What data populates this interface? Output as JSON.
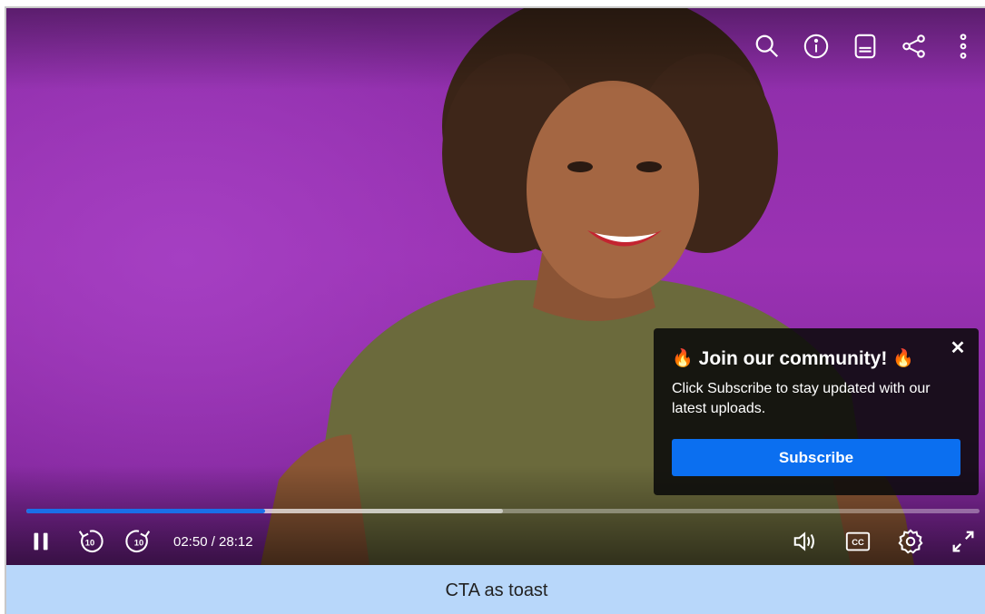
{
  "player": {
    "current_time": "02:50",
    "duration": "28:12",
    "time_display": "02:50 / 28:12",
    "progress_played_fraction": 0.25,
    "progress_buffered_fraction": 0.5,
    "colors": {
      "accent": "#0b6ff0",
      "progress": "#1a6fe8",
      "caption_bg": "#b8d7fa"
    }
  },
  "top_controls": [
    "search-icon",
    "info-icon",
    "transcript-icon",
    "share-icon",
    "more-vertical-icon"
  ],
  "bottom_controls": {
    "left": [
      "pause-icon",
      "rewind-10-icon",
      "forward-10-icon"
    ],
    "right": [
      "volume-icon",
      "closed-captions-icon",
      "settings-icon",
      "fullscreen-icon"
    ],
    "rewind_label": "10",
    "forward_label": "10",
    "cc_label": "CC"
  },
  "toast": {
    "flame": "🔥",
    "title": "Join our community!",
    "message": "Click Subscribe to stay updated with our latest uploads.",
    "button_label": "Subscribe",
    "close_label": "✕"
  },
  "caption": {
    "text": "CTA as toast"
  }
}
